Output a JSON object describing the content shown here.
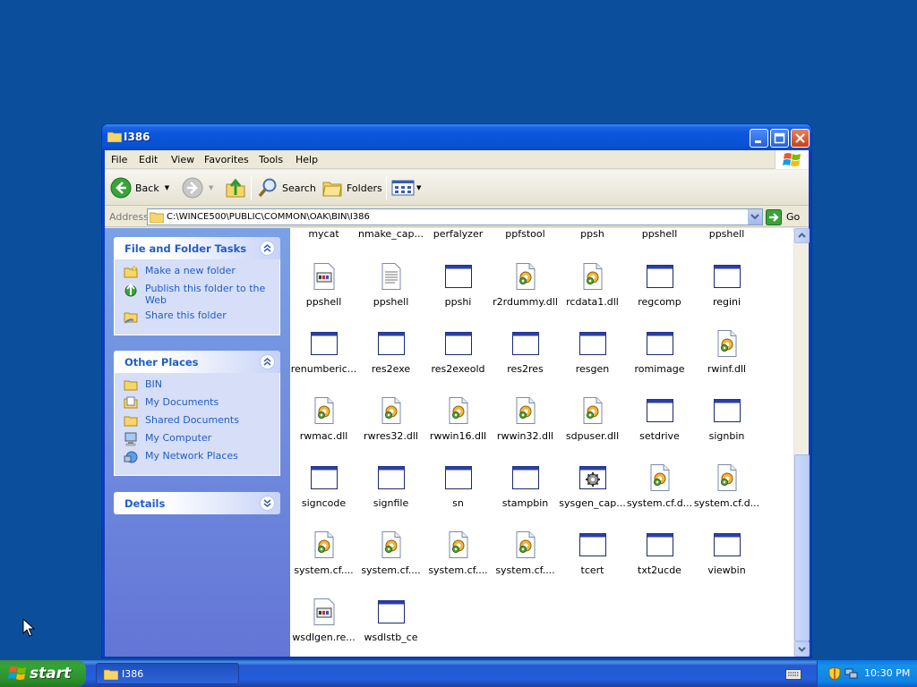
{
  "window": {
    "title": "I386",
    "controls": {
      "minimize": "minimize-icon",
      "maximize": "maximize-icon",
      "close": "close-icon"
    }
  },
  "menu": [
    "File",
    "Edit",
    "View",
    "Favorites",
    "Tools",
    "Help"
  ],
  "toolbar": {
    "back_label": "Back",
    "search_label": "Search",
    "folders_label": "Folders"
  },
  "address": {
    "label": "Address",
    "path": "C:\\WINCE500\\PUBLIC\\COMMON\\OAK\\BIN\\I386",
    "go_label": "Go"
  },
  "taskpane": {
    "file_tasks": {
      "title": "File and Folder Tasks",
      "links": [
        "Make a new folder",
        "Publish this folder to the Web",
        "Share this folder"
      ]
    },
    "other_places": {
      "title": "Other Places",
      "links": [
        "BIN",
        "My Documents",
        "Shared Documents",
        "My Computer",
        "My Network Places"
      ]
    },
    "details": {
      "title": "Details"
    }
  },
  "files": [
    {
      "name": "mycat",
      "type": "top"
    },
    {
      "name": "nmake_cap...",
      "type": "top"
    },
    {
      "name": "perfalyzer",
      "type": "top"
    },
    {
      "name": "ppfstool",
      "type": "top"
    },
    {
      "name": "ppsh",
      "type": "top"
    },
    {
      "name": "ppshell",
      "type": "top"
    },
    {
      "name": "ppshell",
      "type": "top"
    },
    {
      "name": "ppshell",
      "type": "reg"
    },
    {
      "name": "ppshell",
      "type": "doc"
    },
    {
      "name": "ppshi",
      "type": "exe"
    },
    {
      "name": "r2rdummy.dll",
      "type": "dll"
    },
    {
      "name": "rcdata1.dll",
      "type": "dll"
    },
    {
      "name": "regcomp",
      "type": "exe"
    },
    {
      "name": "regini",
      "type": "exe"
    },
    {
      "name": "renumberic...",
      "type": "exe"
    },
    {
      "name": "res2exe",
      "type": "exe"
    },
    {
      "name": "res2exeold",
      "type": "exe"
    },
    {
      "name": "res2res",
      "type": "exe"
    },
    {
      "name": "resgen",
      "type": "exe"
    },
    {
      "name": "romimage",
      "type": "exe"
    },
    {
      "name": "rwinf.dll",
      "type": "dll"
    },
    {
      "name": "rwmac.dll",
      "type": "dll"
    },
    {
      "name": "rwres32.dll",
      "type": "dll"
    },
    {
      "name": "rwwin16.dll",
      "type": "dll"
    },
    {
      "name": "rwwin32.dll",
      "type": "dll"
    },
    {
      "name": "sdpuser.dll",
      "type": "dll"
    },
    {
      "name": "setdrive",
      "type": "exe"
    },
    {
      "name": "signbin",
      "type": "exe"
    },
    {
      "name": "signcode",
      "type": "exe"
    },
    {
      "name": "signfile",
      "type": "exe"
    },
    {
      "name": "sn",
      "type": "exe"
    },
    {
      "name": "stampbin",
      "type": "exe"
    },
    {
      "name": "sysgen_cap...",
      "type": "gear"
    },
    {
      "name": "system.cf.d...",
      "type": "dll"
    },
    {
      "name": "system.cf.d...",
      "type": "dll"
    },
    {
      "name": "system.cf....",
      "type": "dll"
    },
    {
      "name": "system.cf....",
      "type": "dll"
    },
    {
      "name": "system.cf....",
      "type": "dll"
    },
    {
      "name": "system.cf....",
      "type": "dll"
    },
    {
      "name": "tcert",
      "type": "exe"
    },
    {
      "name": "txt2ucde",
      "type": "exe"
    },
    {
      "name": "viewbin",
      "type": "exe"
    },
    {
      "name": "wsdlgen.re...",
      "type": "reg"
    },
    {
      "name": "wsdlstb_ce",
      "type": "exe"
    }
  ],
  "taskbar": {
    "start_label": "start",
    "task_label": "I386",
    "clock": "10:30 PM"
  },
  "colors": {
    "desktop": "#0b4f9c",
    "titlebar": "#0a55db",
    "taskpane_link": "#215dc6"
  }
}
